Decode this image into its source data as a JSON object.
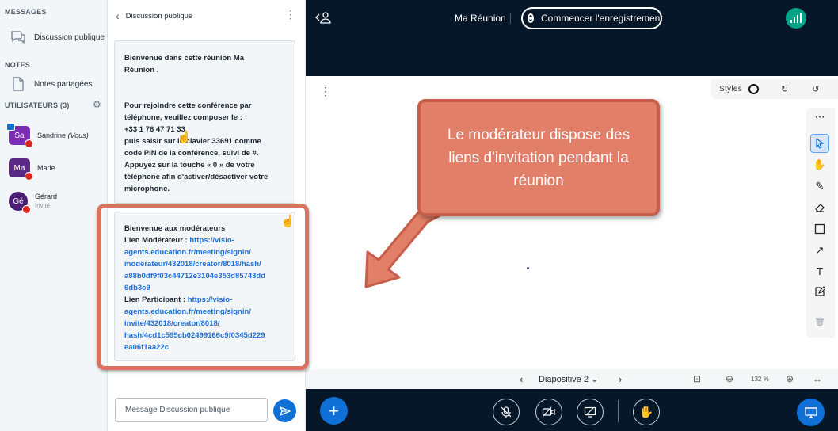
{
  "sidebar": {
    "messages_title": "MESSAGES",
    "public_chat_label": "Discussion publique",
    "notes_title": "NOTES",
    "shared_notes_label": "Notes partagées",
    "users_title": "UTILISATEURS (3)",
    "users": [
      {
        "initials": "Sa",
        "name": "Sandrine",
        "suffix": "(Vous)",
        "sub": "",
        "color": "#7c2bb3"
      },
      {
        "initials": "Ma",
        "name": "Marie",
        "suffix": "",
        "sub": "",
        "color": "#5b2a86"
      },
      {
        "initials": "Gé",
        "name": "Gérard",
        "suffix": "",
        "sub": "Invité",
        "color": "#4a1f73"
      }
    ]
  },
  "chat": {
    "title": "Discussion publique",
    "welcome_lines": [
      "Bienvenue dans cette réunion Ma",
      "Réunion .",
      "",
      "Pour rejoindre cette conférence par",
      "téléphone, veuillez composer le :",
      "+33 1 76 47 71 33",
      "puis saisir sur le clavier 33691 comme",
      "code PIN de la conférence, suivi de #.",
      "Appuyez sur la touche « 0 » de votre",
      "téléphone afin d'activer/désactiver votre",
      "microphone."
    ],
    "moderator_title": "Bienvenue aux modérateurs",
    "moderator_link_label": "Lien Modérateur  : ",
    "moderator_link_lines": [
      "https://visio-",
      "agents.education.fr/meeting/signin/",
      "moderateur/432018/creator/8018/hash/",
      "a88b0df9f03c44712e3104e353d85743dd",
      "6db3c9"
    ],
    "participant_link_label": "Lien Participant  : ",
    "participant_link_lines": [
      "https://visio-",
      "agents.education.fr/meeting/signin/",
      "invite/432018/creator/8018/",
      "hash/4cd1c595cb02499166c9f0345d229",
      "ea06f1aa22c"
    ],
    "input_placeholder": "Message Discussion publique"
  },
  "topbar": {
    "meeting_title": "Ma Réunion",
    "record_label": "Commencer l'enregistrement"
  },
  "whiteboard": {
    "styles_label": "Styles",
    "slide_label": "Diapositive 2",
    "zoom_label": "132 %"
  },
  "callout": {
    "text": "Le modérateur dispose des liens d'invitation pendant la réunion"
  },
  "colors": {
    "accent": "#0f70d7",
    "dark_bar": "#06172a",
    "callout": "#e27f69",
    "connection": "#02a388"
  }
}
